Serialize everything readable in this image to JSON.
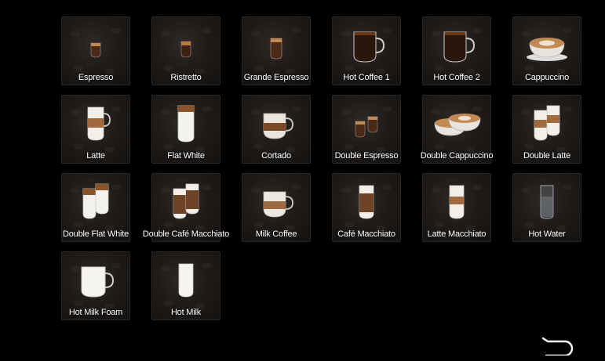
{
  "menu": {
    "items": [
      {
        "label": "Espresso",
        "icon": "espresso-cup-icon"
      },
      {
        "label": "Ristretto",
        "icon": "ristretto-cup-icon"
      },
      {
        "label": "Grande Espresso",
        "icon": "grande-espresso-cup-icon"
      },
      {
        "label": "Hot Coffee 1",
        "icon": "coffee-mug-icon"
      },
      {
        "label": "Hot Coffee 2",
        "icon": "coffee-mug-icon"
      },
      {
        "label": "Cappuccino",
        "icon": "cappuccino-cup-icon"
      },
      {
        "label": "Latte",
        "icon": "latte-glass-icon"
      },
      {
        "label": "Flat White",
        "icon": "flat-white-glass-icon"
      },
      {
        "label": "Cortado",
        "icon": "cortado-cup-icon"
      },
      {
        "label": "Double Espresso",
        "icon": "double-espresso-cups-icon"
      },
      {
        "label": "Double Cappuccino",
        "icon": "double-cappuccino-cups-icon"
      },
      {
        "label": "Double Latte",
        "icon": "double-latte-glasses-icon"
      },
      {
        "label": "Double Flat White",
        "icon": "double-flat-white-glasses-icon"
      },
      {
        "label": "Double Café Macchiato",
        "icon": "double-cafe-macchiato-glasses-icon"
      },
      {
        "label": "Milk Coffee",
        "icon": "milk-coffee-cup-icon"
      },
      {
        "label": "Café Macchiato",
        "icon": "cafe-macchiato-glass-icon"
      },
      {
        "label": "Latte Macchiato",
        "icon": "latte-macchiato-glass-icon"
      },
      {
        "label": "Hot Water",
        "icon": "water-glass-icon"
      },
      {
        "label": "Hot Milk Foam",
        "icon": "milk-foam-mug-icon"
      },
      {
        "label": "Hot Milk",
        "icon": "milk-glass-icon"
      }
    ]
  },
  "footer": {
    "back_icon": "back-arrow-icon"
  },
  "colors": {
    "background": "#000000",
    "tile": "#1e1b19",
    "label": "#ffffff",
    "coffee": "#4a2a17",
    "crema": "#c08a55",
    "milk": "#f2efe9"
  }
}
